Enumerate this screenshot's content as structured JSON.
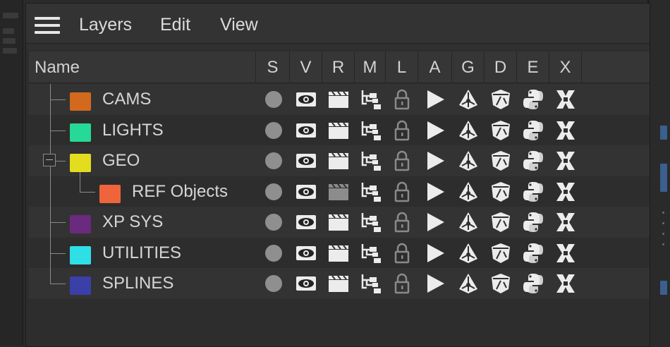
{
  "menu": {
    "items": [
      {
        "label": "Layers"
      },
      {
        "label": "Edit"
      },
      {
        "label": "View"
      }
    ]
  },
  "columns": [
    {
      "label": "Name"
    },
    {
      "label": "S"
    },
    {
      "label": "V"
    },
    {
      "label": "R"
    },
    {
      "label": "M"
    },
    {
      "label": "L"
    },
    {
      "label": "A"
    },
    {
      "label": "G"
    },
    {
      "label": "D"
    },
    {
      "label": "E"
    },
    {
      "label": "X"
    }
  ],
  "layers": [
    {
      "name": "CAMS",
      "color": "#d2691e",
      "depth": 0
    },
    {
      "name": "LIGHTS",
      "color": "#26d996",
      "depth": 0
    },
    {
      "name": "GEO",
      "color": "#e3dc1f",
      "depth": 0
    },
    {
      "name": "REF Objects",
      "color": "#f0643c",
      "depth": 1
    },
    {
      "name": "XP SYS",
      "color": "#6a2a7e",
      "depth": 0
    },
    {
      "name": "UTILITIES",
      "color": "#2ee0e6",
      "depth": 0
    },
    {
      "name": "SPLINES",
      "color": "#3b3fa8",
      "depth": 0
    }
  ],
  "colors": {
    "icon": "#ececec",
    "solo_dot": "#8f8f8f",
    "render_disabled": "#8c8c8c"
  }
}
